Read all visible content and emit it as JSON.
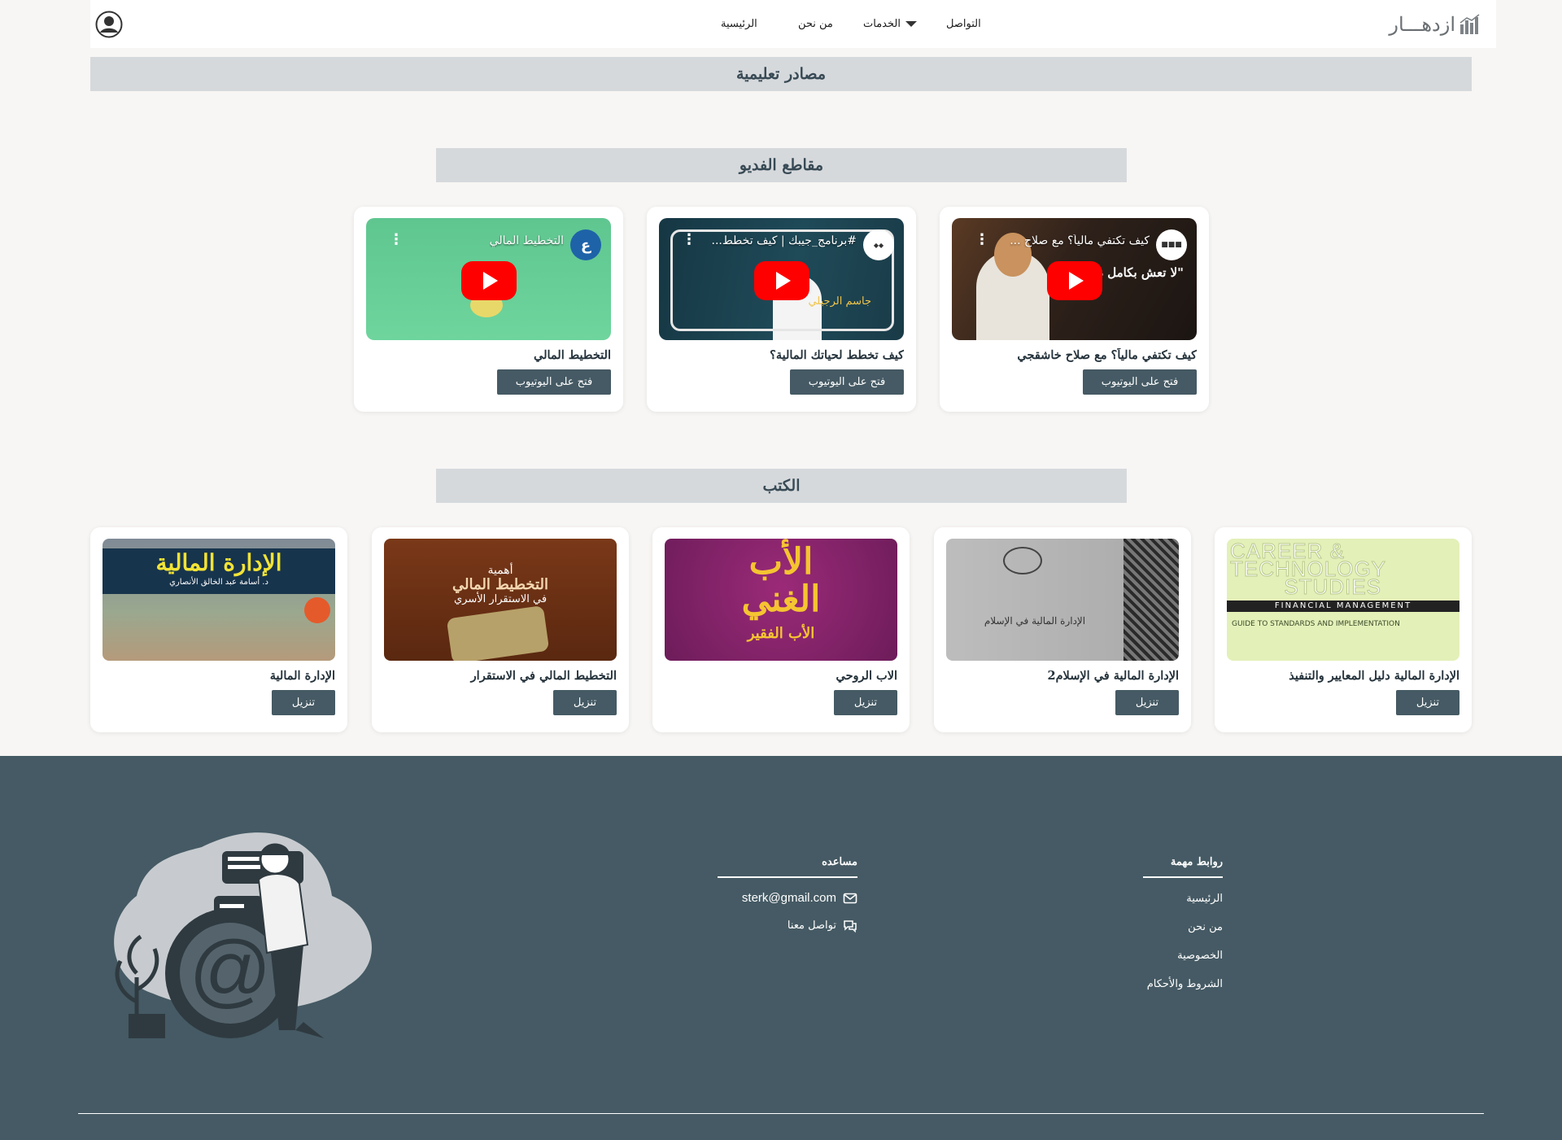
{
  "nav": {
    "logo_text": "ازدهـــار",
    "links": {
      "home": "الرئيسية",
      "about": "من نحن",
      "services": "الخدمات",
      "contact": "التواصل"
    }
  },
  "page_title": "مصادر تعليمية",
  "videos": {
    "heading": "مقاطع الفديو",
    "items": [
      {
        "title": "كيف تكتفي مالياً؟ مع صلاح خاشقجي",
        "thumb_title": "كيف تكتفي مالياً؟ مع صلاح ...",
        "button": "فتح على اليوتيوب",
        "overlay": "\"لا تعش بكامل دخلك\""
      },
      {
        "title": "كيف تخطط لحياتك المالية؟",
        "thumb_title": "#برنامج_جيبك | كيف تخطط...",
        "button": "فتح على اليوتيوب",
        "overlay": "جاسم الرجيلي"
      },
      {
        "title": "التخطيط المالي",
        "thumb_title": "التخطيط المالي",
        "button": "فتح على اليوتيوب",
        "channel_letter": "ع"
      }
    ]
  },
  "books": {
    "heading": "الكتب",
    "items": [
      {
        "title": "الإدارة المالية دليل المعايير والتنفيذ",
        "button": "تنزيل",
        "cover_l1": "CAREER &",
        "cover_l2": "TECHNOLOGY",
        "cover_l3": "STUDIES",
        "cover_band": "FINANCIAL MANAGEMENT",
        "cover_sub": "GUIDE TO STANDARDS AND IMPLEMENTATION"
      },
      {
        "title": "الإدارة المالية في الإسلام2",
        "button": "تنزيل",
        "cover_text": "الإدارة المالية في الإسلام"
      },
      {
        "title": "الاب الروحي",
        "button": "تنزيل",
        "cover_l1": "الأب",
        "cover_l2": "الغني",
        "cover_l3": "الأب الفقير"
      },
      {
        "title": "التخطيط المالي في الاستقرار",
        "button": "تنزيل",
        "cover_l1": "أهمية",
        "cover_l2": "التخطيط المالي",
        "cover_l3": "في الاستقرار الأسري"
      },
      {
        "title": "الإدارة المالية",
        "button": "تنزيل",
        "cover_l1": "الإدارة المالية",
        "cover_l2": "د. أسامة عبد الخالق الأنصاري"
      }
    ]
  },
  "footer": {
    "links_heading": "روابط مهمة",
    "links": [
      "الرئيسية",
      "من نحن",
      "الخصوصية",
      "الشروط والأحكام"
    ],
    "help_heading": "مساعده",
    "email": "sterk@gmail.com",
    "contact": "تواصل معنا"
  },
  "colors": {
    "primary": "#455a64",
    "banner": "#d6d9dc",
    "youtube_red": "#ff0000"
  }
}
